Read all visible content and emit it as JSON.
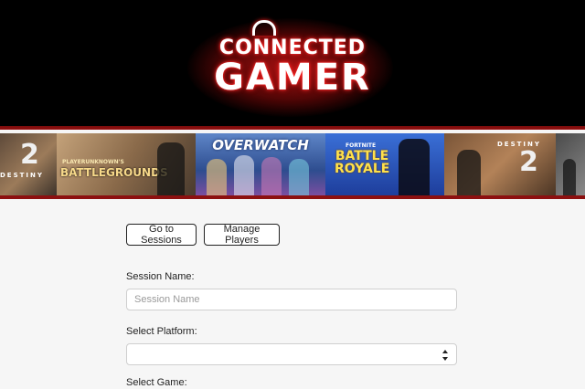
{
  "header": {
    "logo_line1": "CONNECTED",
    "logo_line2": "GAMER",
    "logo_icon": "headset-icon",
    "colors": {
      "background": "#000000",
      "glow": "#c81414",
      "accent_bar": "#8c1010"
    }
  },
  "banner": {
    "tiles": [
      {
        "name": "destiny-2-left",
        "brand": "DESTINY",
        "numeral": "2"
      },
      {
        "name": "pubg",
        "subtitle": "PLAYERUNKNOWN'S",
        "title": "BATTLEGROUNDS"
      },
      {
        "name": "overwatch",
        "title": "OVERWATCH"
      },
      {
        "name": "fortnite",
        "subtitle": "FORTNITE",
        "title": "BATTLE ROYALE"
      },
      {
        "name": "destiny-2-right",
        "brand": "DESTINY",
        "numeral": "2"
      }
    ]
  },
  "nav": {
    "go_sessions_label": "Go to Sessions",
    "manage_players_label": "Manage Players"
  },
  "form": {
    "session_name_label": "Session Name:",
    "session_name_placeholder": "Session Name",
    "session_name_value": "",
    "platform_label": "Select Platform:",
    "platform_value": "",
    "game_label": "Select Game:"
  }
}
